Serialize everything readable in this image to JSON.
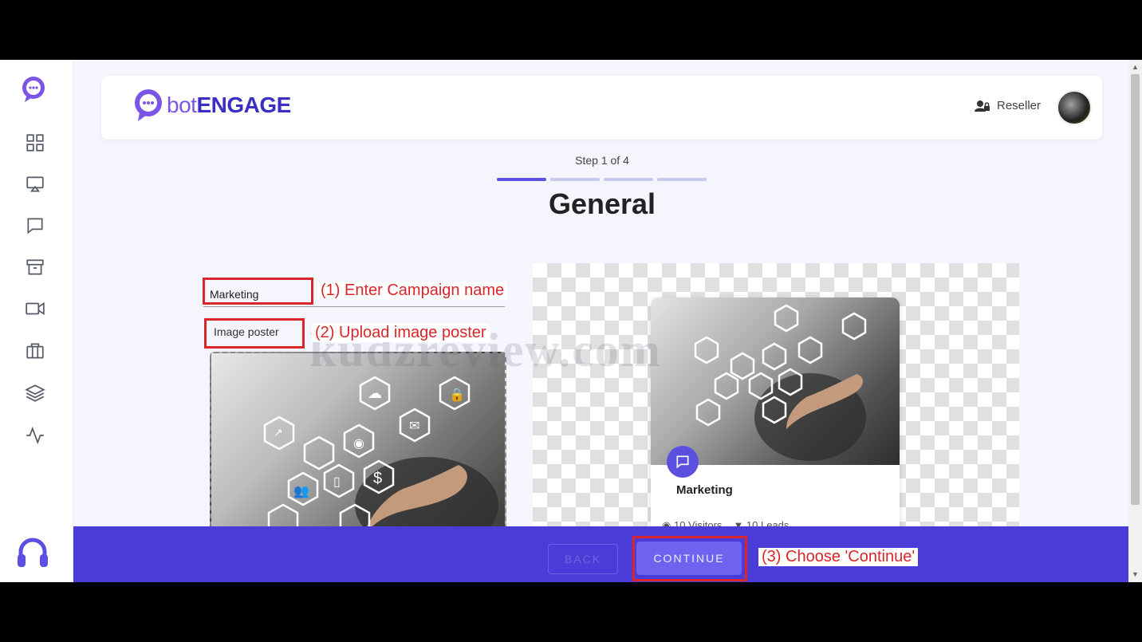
{
  "header": {
    "brand_prefix": "bot",
    "brand_suffix": "ENGAGE",
    "reseller_label": "Reseller"
  },
  "sidebar": {
    "items": [
      {
        "icon": "dashboard-grid-icon"
      },
      {
        "icon": "cast-icon"
      },
      {
        "icon": "chat-bubble-icon"
      },
      {
        "icon": "archive-box-icon"
      },
      {
        "icon": "video-camera-icon"
      },
      {
        "icon": "briefcase-icon"
      },
      {
        "icon": "layers-icon"
      },
      {
        "icon": "activity-pulse-icon"
      }
    ],
    "support_icon": "headphones-icon"
  },
  "wizard": {
    "step_label": "Step 1 of 4",
    "total_steps": 4,
    "current_step": 1,
    "title": "General"
  },
  "form": {
    "campaign_name_value": "Marketing",
    "image_poster_label": "Image poster"
  },
  "preview_card": {
    "title": "Marketing",
    "visitors": "10 Visitors",
    "leads": "10 Leads"
  },
  "footer": {
    "back_label": "BACK",
    "continue_label": "CONTINUE"
  },
  "annotations": {
    "step1": "(1) Enter Campaign name",
    "step2": "(2) Upload image poster",
    "step3": "(3) Choose 'Continue'"
  },
  "watermark": "kudzreview.com",
  "colors": {
    "accent": "#5b50e0",
    "footer_bg": "#4a3cd8",
    "annotation_red": "#d9262a"
  }
}
